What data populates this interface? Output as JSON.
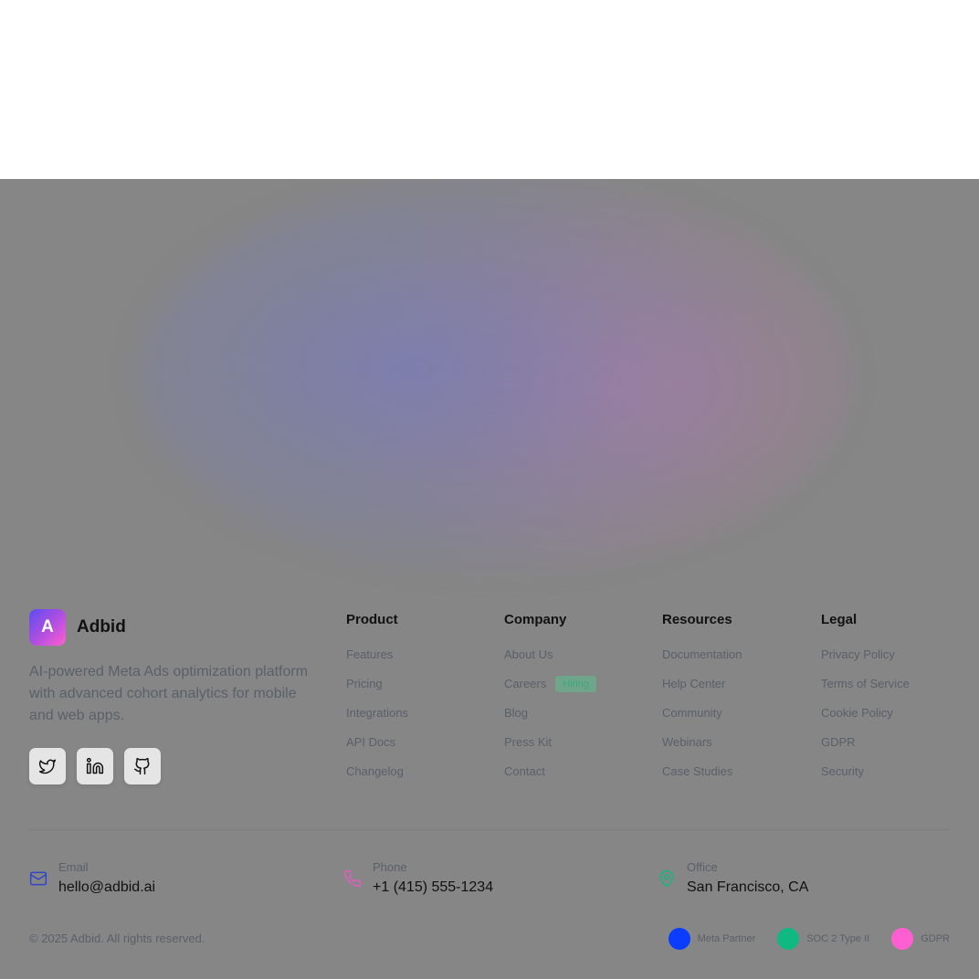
{
  "brand": {
    "logo_letter": "A",
    "name": "Adbid",
    "description": "AI-powered Meta Ads optimization platform with advanced cohort analytics for mobile and web apps."
  },
  "socials": [
    "twitter-icon",
    "linkedin-icon",
    "github-icon"
  ],
  "columns": {
    "product": {
      "title": "Product",
      "links": [
        "Features",
        "Pricing",
        "Integrations",
        "API Docs",
        "Changelog"
      ]
    },
    "company": {
      "title": "Company",
      "links": [
        "About Us",
        "Careers",
        "Blog",
        "Press Kit",
        "Contact"
      ],
      "careers_badge": "Hiring"
    },
    "resources": {
      "title": "Resources",
      "links": [
        "Documentation",
        "Help Center",
        "Community",
        "Webinars",
        "Case Studies"
      ]
    },
    "legal": {
      "title": "Legal",
      "links": [
        "Privacy Policy",
        "Terms of Service",
        "Cookie Policy",
        "GDPR",
        "Security"
      ]
    }
  },
  "contact": {
    "email": {
      "label": "Email",
      "value": "hello@adbid.ai",
      "icon": "mail-icon"
    },
    "phone": {
      "label": "Phone",
      "value": "+1 (415) 555-1234",
      "icon": "phone-icon"
    },
    "office": {
      "label": "Office",
      "value": "San Francisco, CA",
      "icon": "map-pin-icon"
    }
  },
  "copyright": "© 2025 Adbid. All rights reserved.",
  "certs": [
    {
      "label": "Meta Partner",
      "color": "#0a3dff"
    },
    {
      "label": "SOC 2 Type II",
      "color": "#10b981"
    },
    {
      "label": "GDPR",
      "color": "#ff5fd0"
    }
  ],
  "colors": {
    "overlay": "#868686",
    "text_muted": "#5a5f69",
    "email_icon": "#2f47c8",
    "phone_icon": "#e05fc0",
    "office_icon": "#10b981"
  }
}
